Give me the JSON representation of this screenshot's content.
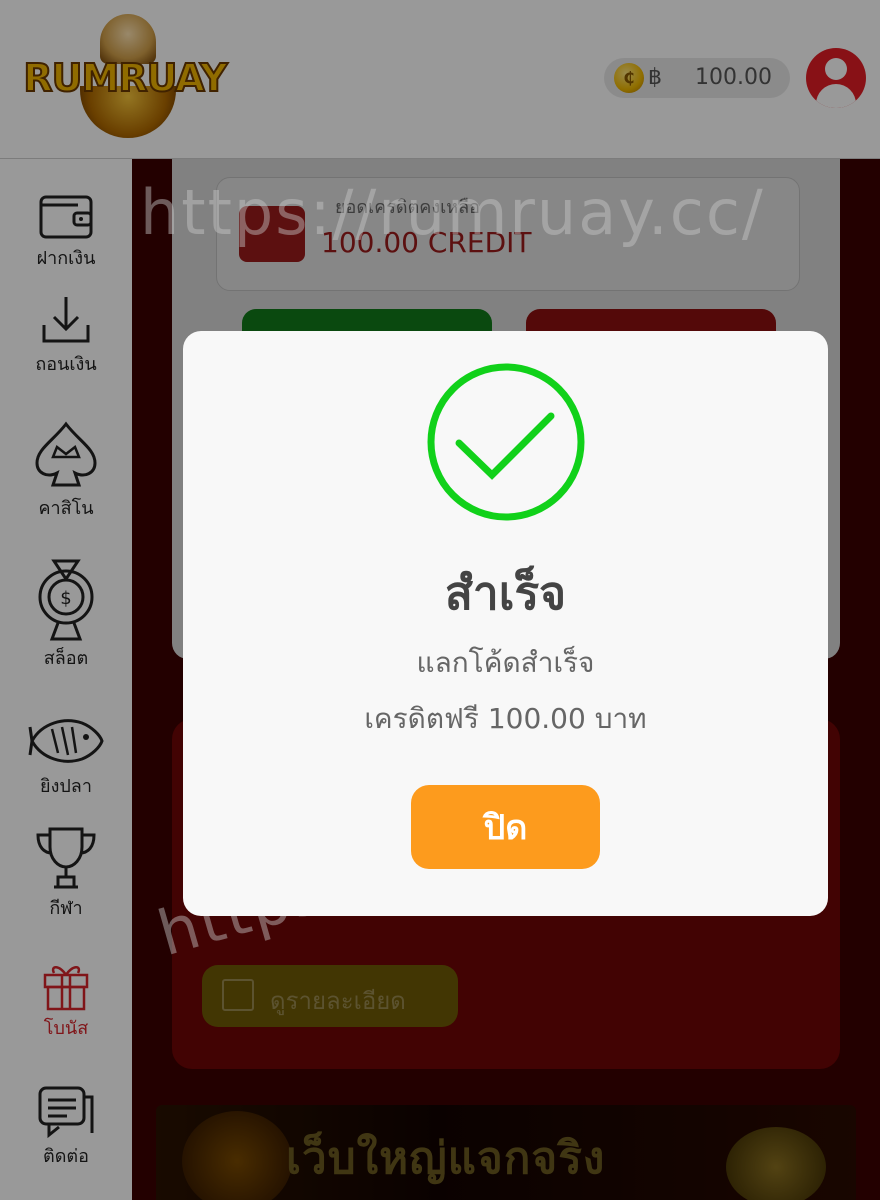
{
  "header": {
    "logo_text": "RUMRUAY",
    "currency_symbol": "฿",
    "coin_symbol": "₵",
    "balance": "100.00"
  },
  "sidebar": {
    "items": [
      {
        "label": "ฝากเงิน",
        "icon": "wallet-icon"
      },
      {
        "label": "ถอนเงิน",
        "icon": "download-icon"
      },
      {
        "label": "คาสิโน",
        "icon": "spade-crown-icon"
      },
      {
        "label": "สล็อต",
        "icon": "slot-machine-icon"
      },
      {
        "label": "ยิงปลา",
        "icon": "fish-icon"
      },
      {
        "label": "กีฬา",
        "icon": "trophy-icon"
      },
      {
        "label": "โบนัส",
        "icon": "gift-icon",
        "active": true
      },
      {
        "label": "ติดต่อ",
        "icon": "chat-icon"
      }
    ]
  },
  "main": {
    "credit_label": "ยอดเครดิตคงเหลือ",
    "credit_amount": "100.00 CREDIT",
    "detail_button": "ดูรายละเอียด",
    "banner_text": "เว็บใหญ่แจกจริง"
  },
  "watermark": "https://rumruay.cc/",
  "modal": {
    "title": "สำเร็จ",
    "line1": "แลกโค้ดสำเร็จ",
    "line2": "เครดิตฟรี 100.00 บาท",
    "close_label": "ปิด"
  },
  "colors": {
    "accent_orange": "#fd9b1d",
    "success_green": "#11d11a",
    "brand_red": "#e31d25"
  }
}
